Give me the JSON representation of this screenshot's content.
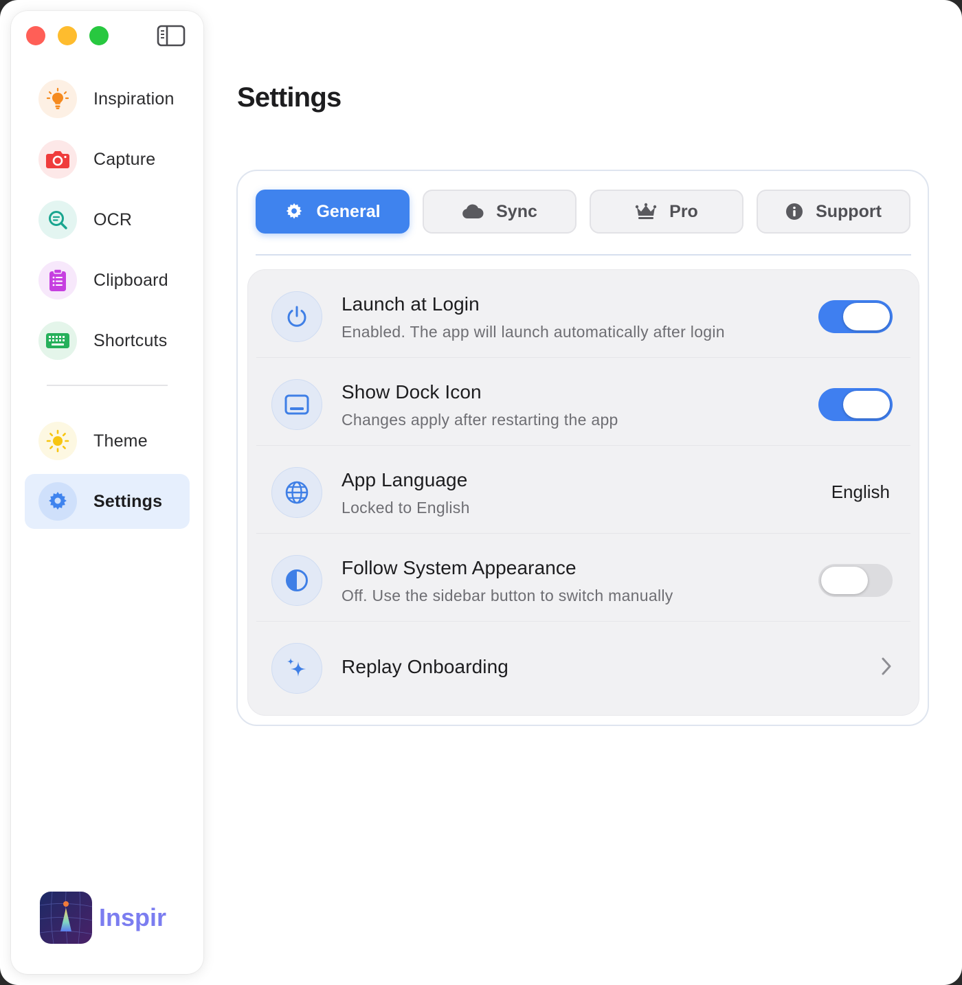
{
  "sidebar": {
    "items": [
      {
        "label": "Inspiration",
        "icon": "lightbulb-icon",
        "color": "#f58a1f"
      },
      {
        "label": "Capture",
        "icon": "camera-icon",
        "color": "#ef3c3c"
      },
      {
        "label": "OCR",
        "icon": "text-search-icon",
        "color": "#19a58f"
      },
      {
        "label": "Clipboard",
        "icon": "clipboard-icon",
        "color": "#c63fe0"
      },
      {
        "label": "Shortcuts",
        "icon": "keyboard-icon",
        "color": "#26b05b"
      }
    ],
    "bottom_items": [
      {
        "label": "Theme",
        "icon": "sun-icon",
        "color": "#f7c511"
      },
      {
        "label": "Settings",
        "icon": "gear-icon",
        "color": "#3f83ee",
        "active": true
      }
    ],
    "brand": {
      "name": "Inspir"
    }
  },
  "main": {
    "title": "Settings",
    "tabs": [
      {
        "label": "General",
        "icon": "gear-icon",
        "active": true
      },
      {
        "label": "Sync",
        "icon": "cloud-icon",
        "active": false
      },
      {
        "label": "Pro",
        "icon": "crown-icon",
        "active": false
      },
      {
        "label": "Support",
        "icon": "info-icon",
        "active": false
      }
    ],
    "settings": [
      {
        "title": "Launch at Login",
        "subtitle": "Enabled. The app will launch automatically after login",
        "icon": "power-icon",
        "control": "toggle",
        "value": true
      },
      {
        "title": "Show Dock Icon",
        "subtitle": "Changes apply after restarting the app",
        "icon": "dock-icon",
        "control": "toggle",
        "value": true
      },
      {
        "title": "App Language",
        "subtitle": "Locked to English",
        "icon": "globe-icon",
        "control": "value",
        "value": "English"
      },
      {
        "title": "Follow System Appearance",
        "subtitle": "Off. Use the sidebar button to switch manually",
        "icon": "contrast-icon",
        "control": "toggle",
        "value": false
      },
      {
        "title": "Replay Onboarding",
        "icon": "sparkles-icon",
        "control": "chevron"
      }
    ]
  },
  "colors": {
    "accent": "#3f83ee",
    "toggle_on": "#3f7ff0",
    "toggle_off": "#dcdcdf"
  }
}
